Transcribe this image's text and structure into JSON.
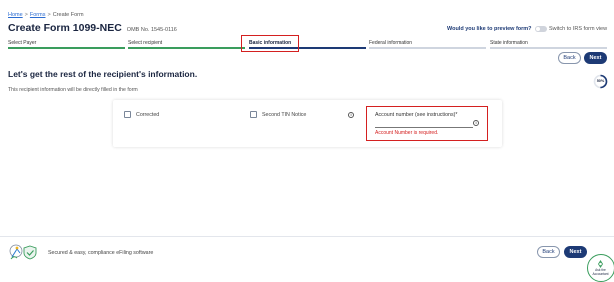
{
  "breadcrumb": {
    "home": "Home",
    "sep1": ">",
    "forms": "Forms",
    "sep2": ">",
    "current": "Create Form"
  },
  "header": {
    "title": "Create Form 1099-NEC",
    "omb": "OMB No. 1545-0116",
    "preview_question": "Would you like to preview form?",
    "toggle_label": "Switch to IRS form view"
  },
  "steps": [
    {
      "label": "Select Payer",
      "state": "done"
    },
    {
      "label": "Select recipient",
      "state": "done"
    },
    {
      "label": "Basic information",
      "state": "active"
    },
    {
      "label": "Federal information",
      "state": "pending"
    },
    {
      "label": "State information",
      "state": "pending"
    }
  ],
  "nav": {
    "back": "Back",
    "next": "Next"
  },
  "section": {
    "heading": "Let's get the rest of the recipient's information.",
    "subtext": "This recipient information will be directly filled in the form",
    "progress": "50%"
  },
  "form": {
    "corrected_label": "Corrected",
    "second_tin_label": "Second TIN Notice",
    "account_label": "Account number (see instructions)*",
    "account_value": "",
    "account_error": "Account Number is required.",
    "info_glyph": "i"
  },
  "footer": {
    "text": "Secured & easy, compliance eFiling software",
    "back": "Back",
    "next": "Next",
    "help_line1": "Ask the",
    "help_line2": "Accountant"
  },
  "colors": {
    "primary": "#1d3a75",
    "done": "#3a9d5d",
    "error": "#d42020"
  }
}
